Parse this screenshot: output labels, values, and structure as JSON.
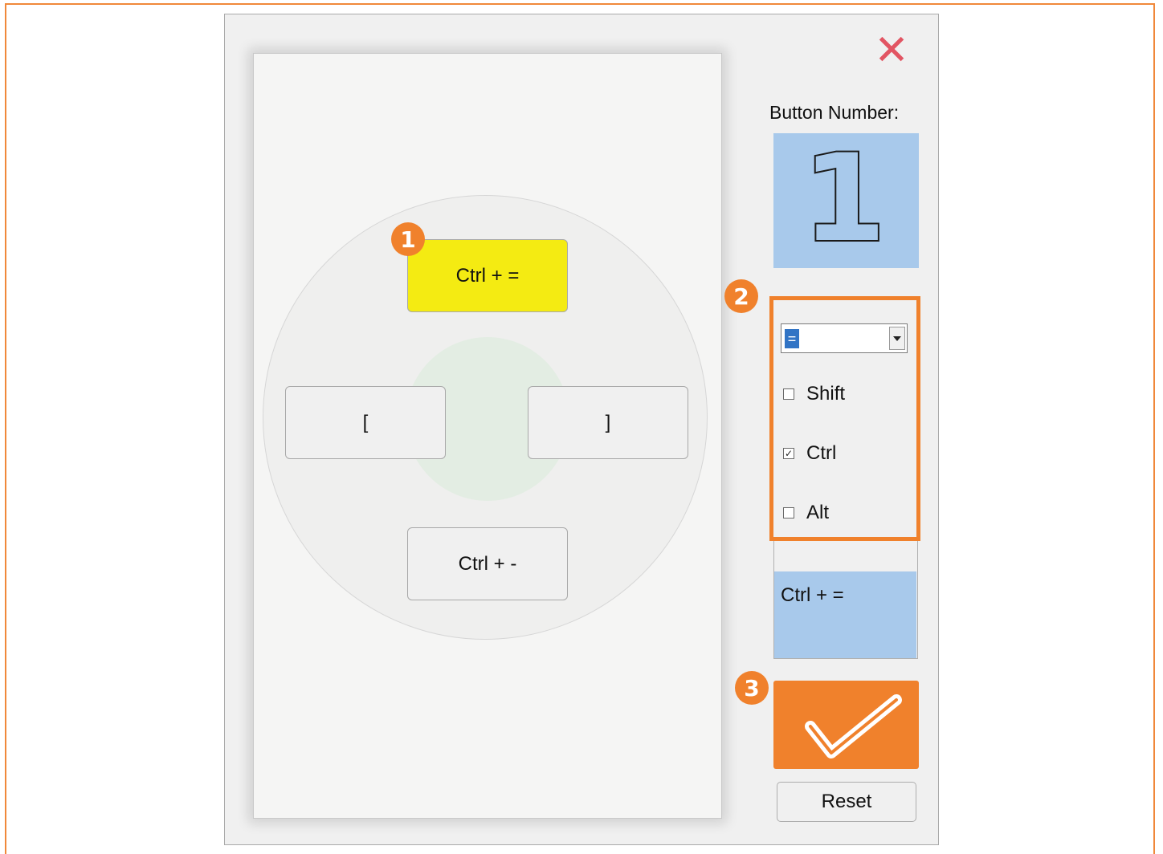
{
  "keys": {
    "top": "Ctrl + =",
    "left": "[",
    "right": "]",
    "bottom": "Ctrl + -"
  },
  "badges": [
    "1",
    "2",
    "3"
  ],
  "close_icon": "close-icon",
  "button_number": {
    "label": "Button Number:",
    "value": "1"
  },
  "key_select": {
    "selected": "="
  },
  "modifiers": [
    {
      "label": "Shift",
      "checked": false
    },
    {
      "label": "Ctrl",
      "checked": true
    },
    {
      "label": "Alt",
      "checked": false
    }
  ],
  "result_text": "Ctrl + =",
  "confirm_icon": "checkmark-icon",
  "reset_label": "Reset",
  "colors": {
    "accent": "#f0812c",
    "active_key": "#f4eb12",
    "highlight_blue": "#a8c9eb",
    "close": "#e25563"
  }
}
